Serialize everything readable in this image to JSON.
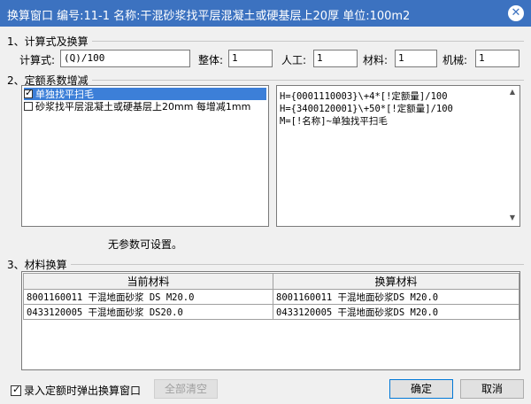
{
  "window": {
    "title": "换算窗口 编号:11-1 名称:干混砂浆找平层混凝土或硬基层上20厚 单位:100m2",
    "close_glyph": "✕"
  },
  "section1": {
    "label": "1、计算式及换算",
    "formula_label": "计算式:",
    "formula_value": "(Q)/100",
    "whole_label": "整体:",
    "whole_value": "1",
    "labor_label": "人工:",
    "labor_value": "1",
    "material_label": "材料:",
    "material_value": "1",
    "machine_label": "机械:",
    "machine_value": "1"
  },
  "section2": {
    "label": "2、定额系数增减",
    "options": [
      {
        "label": "单独找平扫毛",
        "checked": true
      },
      {
        "label": "砂浆找平层混凝土或硬基层上20mm 每增减1mm",
        "checked": false
      }
    ],
    "formulas": [
      "H={0001110003}\\+4*[!定额量]/100",
      "H={3400120001}\\+50*[!定额量]/100",
      "M=[!名称]~单独找平扫毛"
    ],
    "no_params_text": "无参数可设置。"
  },
  "section3": {
    "label": "3、材料换算",
    "columns": [
      "当前材料",
      "换算材料"
    ],
    "rows": [
      [
        "8001160011 干混地面砂浆 DS M20.0",
        "8001160011 干混地面砂浆DS M20.0"
      ],
      [
        "0433120005 干混地面砂浆 DS20.0",
        "0433120005 干混地面砂浆DS M20.0"
      ]
    ]
  },
  "footer": {
    "popup_label": "录入定额时弹出换算窗口",
    "popup_checked": true,
    "clear_all_label": "全部清空",
    "ok_label": "确定",
    "cancel_label": "取消"
  },
  "colors": {
    "titlebar": "#3c72c0",
    "selection": "#3c7fd8"
  }
}
